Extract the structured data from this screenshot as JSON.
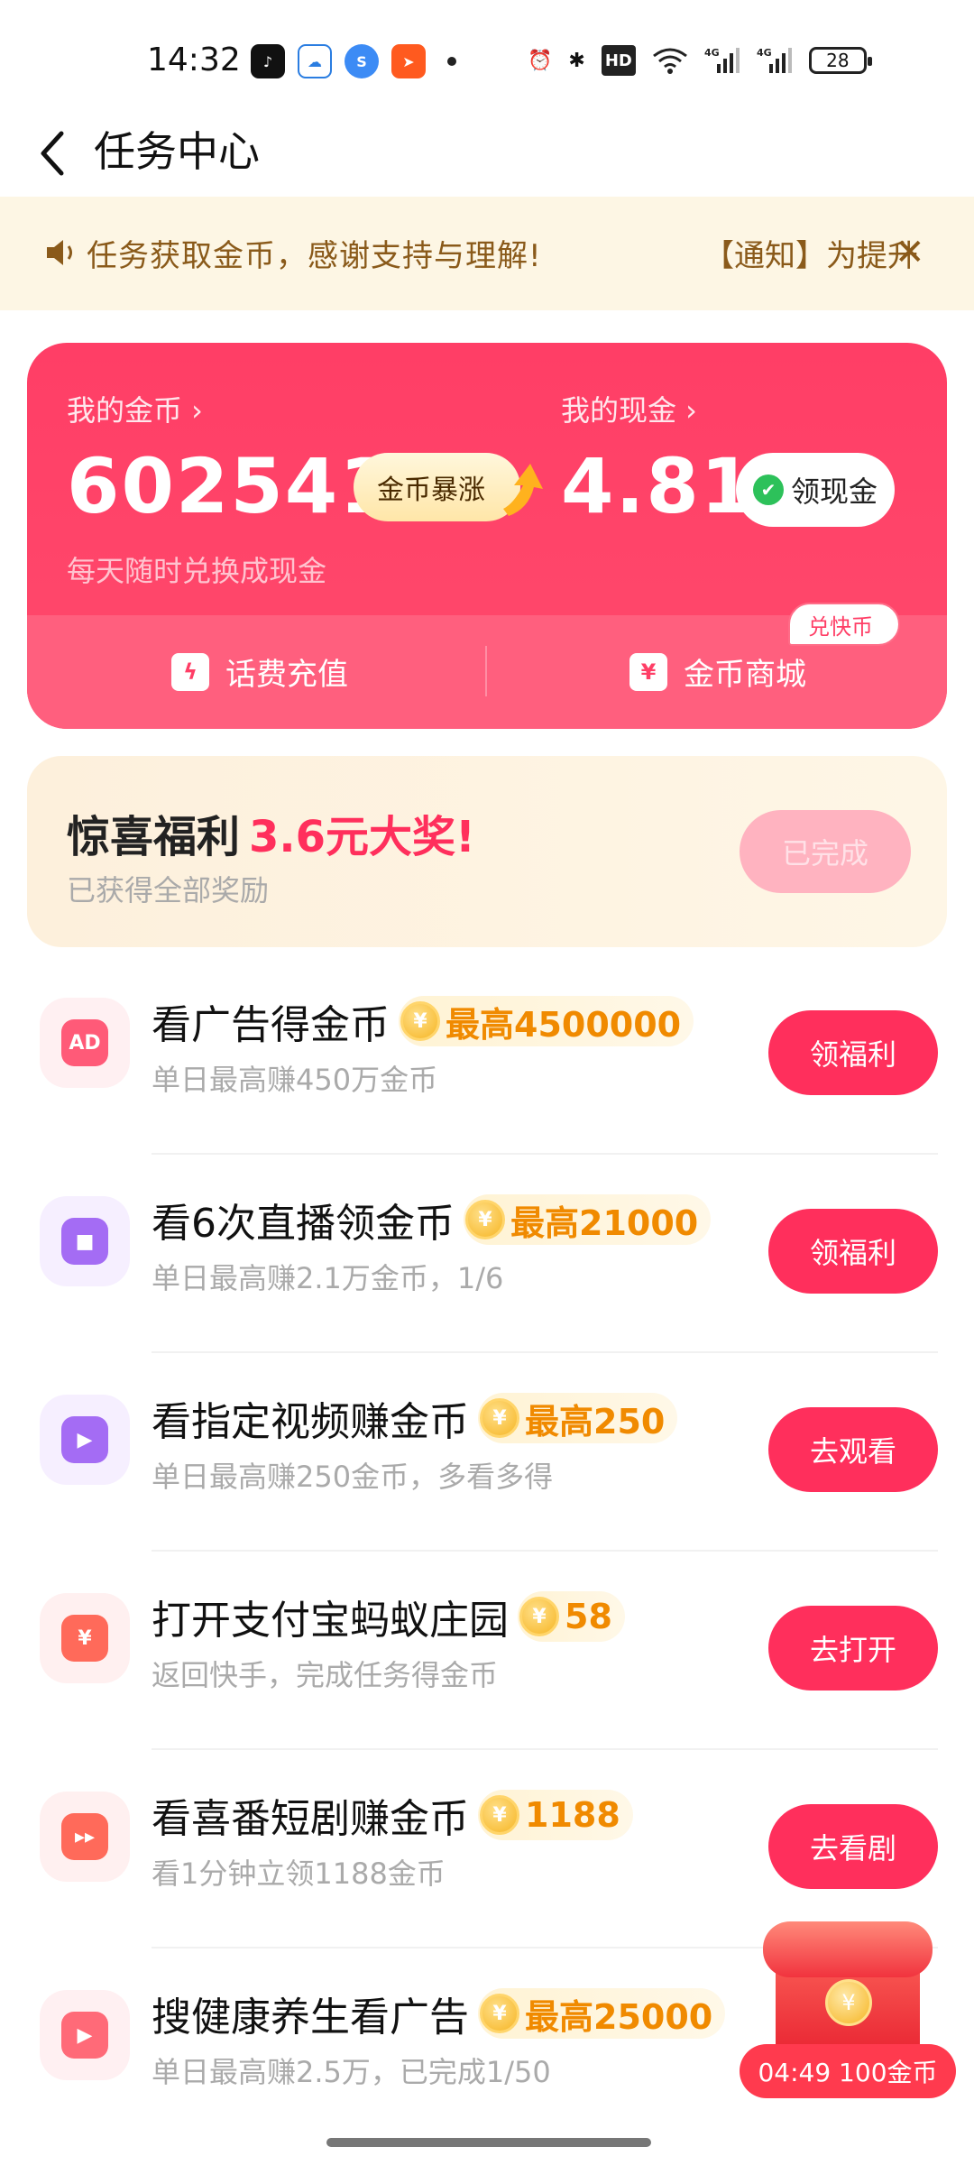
{
  "status_bar": {
    "time": "14:32",
    "battery": "28",
    "icons": [
      "tiktok-icon",
      "cloud-icon",
      "smb-icon",
      "send-icon",
      "alarm-icon",
      "bluetooth-icon",
      "hd-icon",
      "wifi-icon",
      "signal-4g-icon",
      "signal-4g-icon"
    ]
  },
  "header": {
    "title": "任务中心"
  },
  "notice": {
    "text": "任务获取金币，感谢支持与理解!",
    "text2": "【通知】为提升",
    "close": "✕"
  },
  "coin_card": {
    "coins_label": "我的金币 ›",
    "coins_value": "602541",
    "surge_label": "金币暴涨",
    "cash_label": "我的现金 ›",
    "cash_value": "4.81",
    "cashout_label": "领现金",
    "sub_text": "每天随时兑换成现金",
    "recharge_label": "话费充值",
    "mall_label": "金币商城",
    "mall_badge": "兑快币"
  },
  "surprise": {
    "title": "惊喜福利",
    "highlight": "3.6元大奖!",
    "sub": "已获得全部奖励",
    "button": "已完成"
  },
  "tasks": [
    {
      "title": "看广告得金币",
      "reward": "最高4500000",
      "desc": "单日最高赚450万金币",
      "button": "领福利",
      "icon_text": "AD",
      "icon_bg": "#fff0f2",
      "icon_color": "#ff5a78"
    },
    {
      "title": "看6次直播领金币",
      "reward": "最高21000",
      "desc": "单日最高赚2.1万金币，1/6",
      "button": "领福利",
      "icon_text": "■",
      "icon_bg": "#f6efff",
      "icon_color": "#a46cf4"
    },
    {
      "title": "看指定视频赚金币",
      "reward": "最高250",
      "desc": "单日最高赚250金币，多看多得",
      "button": "去观看",
      "icon_text": "▶",
      "icon_bg": "#f6efff",
      "icon_color": "#a46cf4"
    },
    {
      "title": "打开支付宝蚂蚁庄园",
      "reward": "58",
      "desc": "返回快手，完成任务得金币",
      "button": "去打开",
      "icon_text": "¥",
      "icon_bg": "#fff0f0",
      "icon_color": "#ff6a5a"
    },
    {
      "title": "看喜番短剧赚金币",
      "reward": "1188",
      "desc": "看1分钟立领1188金币",
      "button": "去看剧",
      "icon_text": "▸▸",
      "icon_bg": "#fff0f0",
      "icon_color": "#ff6a5a"
    },
    {
      "title": "搜健康养生看广告",
      "reward": "最高25000",
      "desc": "单日最高赚2.5万，已完成1/50",
      "button": "",
      "icon_text": "▶",
      "icon_bg": "#fff0f2",
      "icon_color": "#ff6a78"
    }
  ],
  "float_reward": {
    "label": "04:49 100金币",
    "coin": "¥"
  },
  "colors": {
    "accent": "#ff2f5c",
    "gold": "#f08a00",
    "notice_bg": "#fdf6e4"
  }
}
